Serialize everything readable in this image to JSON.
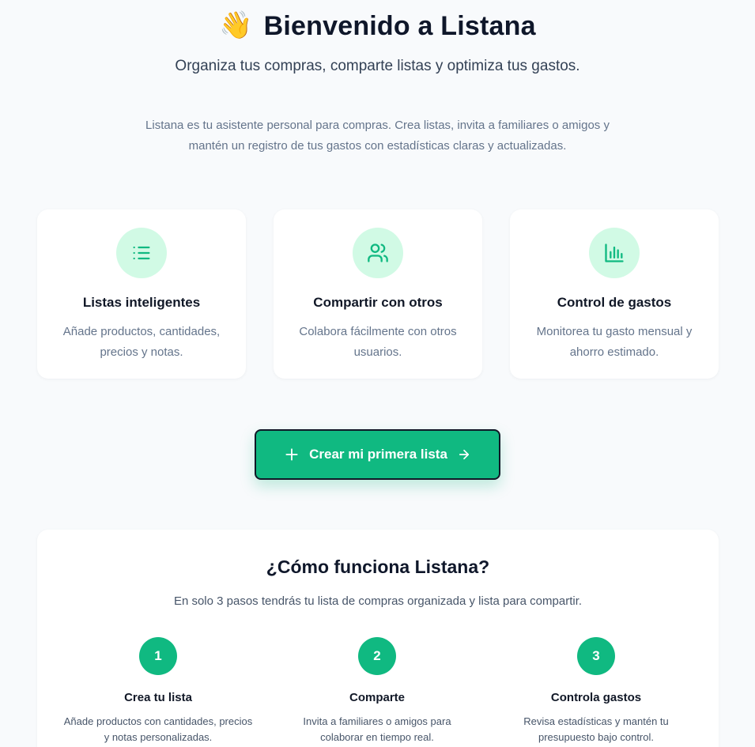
{
  "hero": {
    "icon": "waving-hand-icon",
    "emoji": "👋",
    "title": "Bienvenido a Listana",
    "subtitle": "Organiza tus compras, comparte listas y optimiza tus gastos.",
    "description": "Listana es tu asistente personal para compras. Crea listas, invita a familiares o amigos y mantén un registro de tus gastos con estadísticas claras y actualizadas."
  },
  "features": [
    {
      "icon": "list-icon",
      "title": "Listas inteligentes",
      "description": "Añade productos, cantidades, precios y notas."
    },
    {
      "icon": "users-icon",
      "title": "Compartir con otros",
      "description": "Colabora fácilmente con otros usuarios."
    },
    {
      "icon": "bar-chart-icon",
      "title": "Control de gastos",
      "description": "Monitorea tu gasto mensual y ahorro estimado."
    }
  ],
  "cta": {
    "label": "Crear mi primera lista",
    "icon_left": "plus-icon",
    "icon_right": "arrow-right-icon"
  },
  "how_it_works": {
    "title": "¿Cómo funciona Listana?",
    "subtitle": "En solo 3 pasos tendrás tu lista de compras organizada y lista para compartir.",
    "steps": [
      {
        "number": "1",
        "title": "Crea tu lista",
        "description": "Añade productos con cantidades, precios y notas personalizadas."
      },
      {
        "number": "2",
        "title": "Comparte",
        "description": "Invita a familiares o amigos para colaborar en tiempo real."
      },
      {
        "number": "3",
        "title": "Controla gastos",
        "description": "Revisa estadísticas y mantén tu presupuesto bajo control."
      }
    ]
  },
  "colors": {
    "accent": "#10b981",
    "accent_light": "#d1fae5",
    "background": "#f8fafc",
    "text": "#0f172a",
    "muted": "#64748b"
  }
}
